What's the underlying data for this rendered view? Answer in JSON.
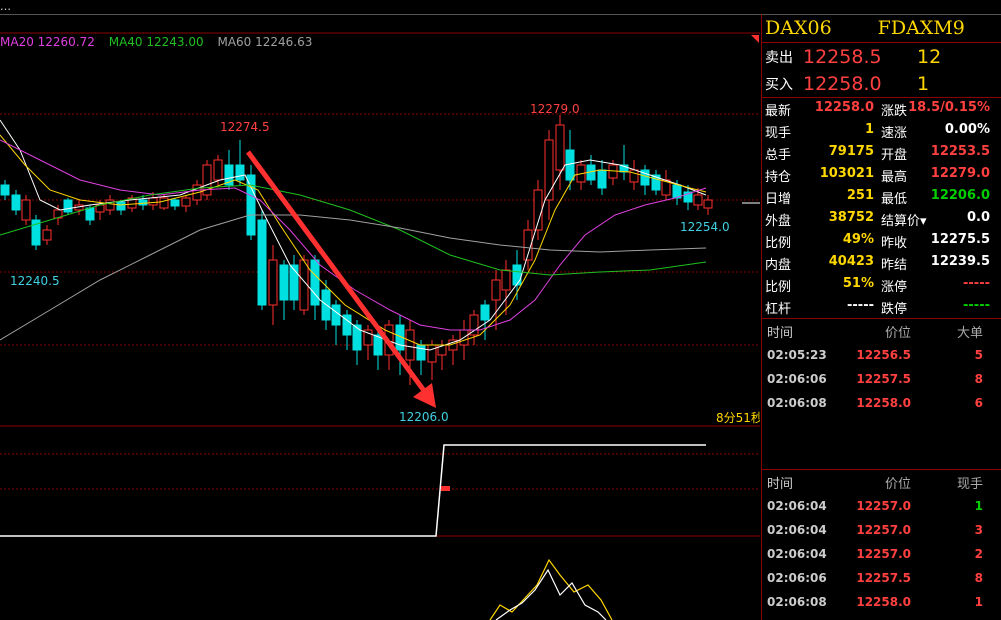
{
  "topbar": {
    "text": "…"
  },
  "ma_legend": [
    {
      "label": "MA20 12260.72",
      "color": "#e040e0"
    },
    {
      "label": "MA40 12243.00",
      "color": "#20c020"
    },
    {
      "label": "MA60 12246.63",
      "color": "#a0a0a0"
    }
  ],
  "chart": {
    "annotations": {
      "high_left": "12274.5",
      "high_right": "12279.0",
      "low_left": "12240.5",
      "low_bottom": "12206.0",
      "last": "12254.0",
      "countdown": "8分51秒"
    }
  },
  "panel": {
    "code": "DAX06",
    "name": "FDAXM9",
    "sell": {
      "label": "卖出",
      "price": "12258.5",
      "vol": "12"
    },
    "buy": {
      "label": "买入",
      "price": "12258.0",
      "vol": "1"
    },
    "stats": [
      [
        {
          "l": "最新",
          "v": "12258.0",
          "c": "red"
        },
        {
          "l": "涨跌",
          "v": "18.5/0.15%",
          "c": "red"
        }
      ],
      [
        {
          "l": "现手",
          "v": "1",
          "c": "yellow"
        },
        {
          "l": "速涨",
          "v": "0.00%",
          "c": "white"
        }
      ],
      [
        {
          "l": "总手",
          "v": "79175",
          "c": "yellow"
        },
        {
          "l": "开盘",
          "v": "12253.5",
          "c": "red"
        }
      ],
      [
        {
          "l": "持仓",
          "v": "103021",
          "c": "yellow"
        },
        {
          "l": "最高",
          "v": "12279.0",
          "c": "red"
        }
      ],
      [
        {
          "l": "日增",
          "v": "251",
          "c": "yellow"
        },
        {
          "l": "最低",
          "v": "12206.0",
          "c": "green"
        }
      ],
      [
        {
          "l": "外盘",
          "v": "38752",
          "c": "yellow"
        },
        {
          "l": "结算价▾",
          "v": "0.0",
          "c": "white"
        }
      ],
      [
        {
          "l": "比例",
          "v": "49%",
          "c": "yellow"
        },
        {
          "l": "昨收",
          "v": "12275.5",
          "c": "white"
        }
      ],
      [
        {
          "l": "内盘",
          "v": "40423",
          "c": "yellow"
        },
        {
          "l": "昨结",
          "v": "12239.5",
          "c": "white"
        }
      ],
      [
        {
          "l": "比例",
          "v": "51%",
          "c": "yellow"
        },
        {
          "l": "涨停",
          "v": "-----",
          "c": "dash"
        }
      ],
      [
        {
          "l": "杠杆",
          "v": "-----",
          "c": "white"
        },
        {
          "l": "跌停",
          "v": "-----",
          "c": "green"
        }
      ]
    ],
    "big_orders": {
      "headers": [
        "时间",
        "价位",
        "大单"
      ],
      "rows": [
        {
          "time": "02:05:23",
          "price": "12256.5",
          "vol": "5",
          "vc": "red"
        },
        {
          "time": "02:06:06",
          "price": "12257.5",
          "vol": "8",
          "vc": "red"
        },
        {
          "time": "02:06:08",
          "price": "12258.0",
          "vol": "6",
          "vc": "red"
        }
      ]
    },
    "ticks": {
      "headers": [
        "时间",
        "价位",
        "现手"
      ],
      "rows": [
        {
          "time": "02:06:04",
          "price": "12257.0",
          "vol": "1",
          "vc": "green"
        },
        {
          "time": "02:06:04",
          "price": "12257.0",
          "vol": "3",
          "vc": "red"
        },
        {
          "time": "02:06:04",
          "price": "12257.0",
          "vol": "2",
          "vc": "red"
        },
        {
          "time": "02:06:06",
          "price": "12257.5",
          "vol": "8",
          "vc": "red"
        },
        {
          "time": "02:06:08",
          "price": "12258.0",
          "vol": "1",
          "vc": "red"
        }
      ]
    }
  }
}
